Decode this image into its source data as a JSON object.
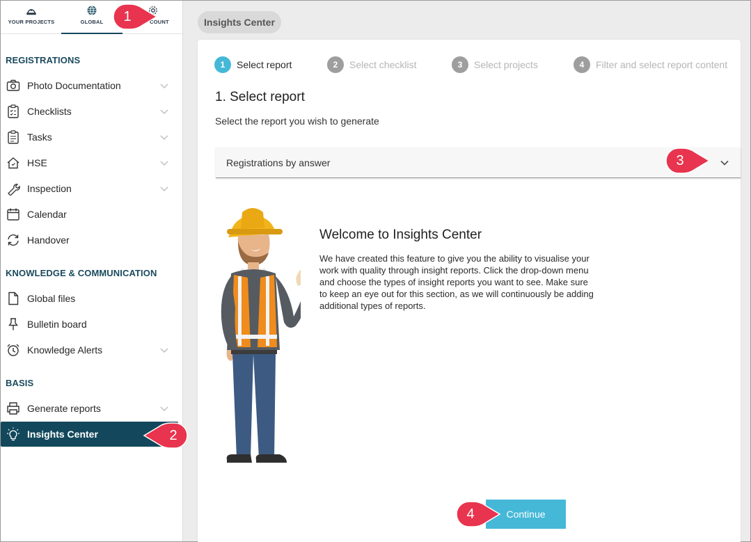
{
  "topnav": {
    "items": [
      {
        "label": "YOUR PROJECTS",
        "icon": "hardhat-icon"
      },
      {
        "label": "GLOBAL",
        "icon": "globe-icon"
      },
      {
        "label": "ACCOUNT",
        "icon": "gear-icon"
      }
    ],
    "active": "GLOBAL",
    "account_visible_label": "COUNT"
  },
  "sidebar": {
    "sections": [
      {
        "title": "REGISTRATIONS",
        "items": [
          {
            "label": "Photo Documentation",
            "icon": "camera-icon",
            "expandable": true
          },
          {
            "label": "Checklists",
            "icon": "checklist-icon",
            "expandable": true
          },
          {
            "label": "Tasks",
            "icon": "clipboard-icon",
            "expandable": true
          },
          {
            "label": "HSE",
            "icon": "house-icon",
            "expandable": true
          },
          {
            "label": "Inspection",
            "icon": "wrench-icon",
            "expandable": true
          },
          {
            "label": "Calendar",
            "icon": "calendar-icon",
            "expandable": false
          },
          {
            "label": "Handover",
            "icon": "sync-icon",
            "expandable": false
          }
        ]
      },
      {
        "title": "KNOWLEDGE & COMMUNICATION",
        "items": [
          {
            "label": "Global files",
            "icon": "file-icon",
            "expandable": false
          },
          {
            "label": "Bulletin board",
            "icon": "pin-icon",
            "expandable": false
          },
          {
            "label": "Knowledge Alerts",
            "icon": "alarm-icon",
            "expandable": true
          }
        ]
      },
      {
        "title": "BASIS",
        "items": [
          {
            "label": "Generate reports",
            "icon": "printer-icon",
            "expandable": true
          },
          {
            "label": "Insights Center",
            "icon": "lightbulb-icon",
            "expandable": false,
            "active": true
          }
        ]
      }
    ]
  },
  "breadcrumb": "Insights Center",
  "steps": [
    {
      "num": "1",
      "label": "Select report",
      "active": true
    },
    {
      "num": "2",
      "label": "Select checklist",
      "active": false
    },
    {
      "num": "3",
      "label": "Select projects",
      "active": false
    },
    {
      "num": "4",
      "label": "Filter and select report content",
      "active": false
    }
  ],
  "main": {
    "heading": "1. Select report",
    "subheading": "Select the report you wish to generate",
    "report_select": {
      "value": "Registrations by answer"
    },
    "welcome_title": "Welcome to Insights Center",
    "welcome_text": "We have created this feature to give you the ability to visualise your work with quality through insight reports. Click the drop-down menu and choose the types of insight reports you want to see. Make sure to keep an eye out for this section, as we will continuously be adding additional types of reports.",
    "continue_label": "Continue"
  },
  "callouts": [
    "1",
    "2",
    "3",
    "4"
  ],
  "colors": {
    "brand_dark": "#13485c",
    "accent": "#45b8d8",
    "callout": "#e8344e"
  }
}
